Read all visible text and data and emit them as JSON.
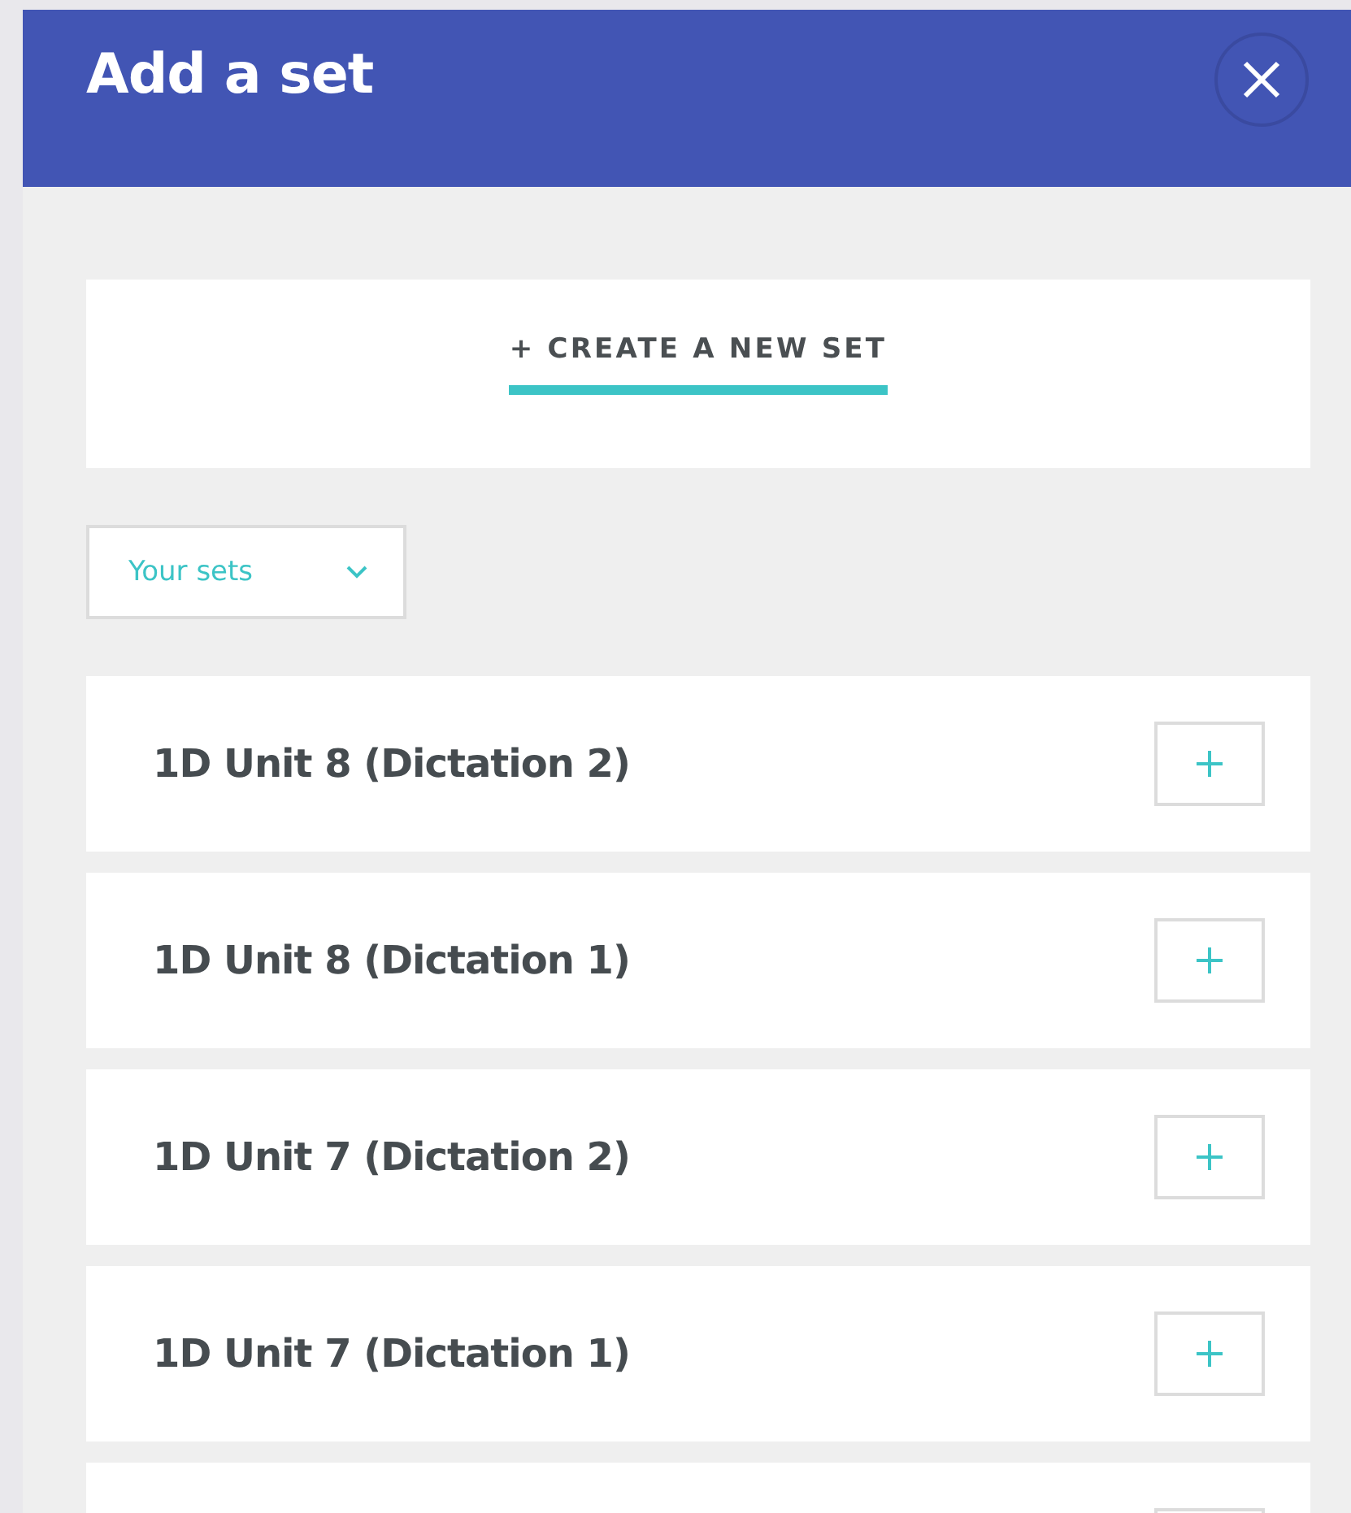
{
  "header": {
    "title": "Add a set"
  },
  "tabs": [
    {
      "label": "+ CREATE A NEW SET",
      "selected": true
    }
  ],
  "filter": {
    "value": "Your sets"
  },
  "sets": [
    {
      "title": "1D Unit 8 (Dictation 2)"
    },
    {
      "title": "1D Unit 8 (Dictation 1)"
    },
    {
      "title": "1D Unit 7 (Dictation 2)"
    },
    {
      "title": "1D Unit 7 (Dictation 1)"
    }
  ]
}
